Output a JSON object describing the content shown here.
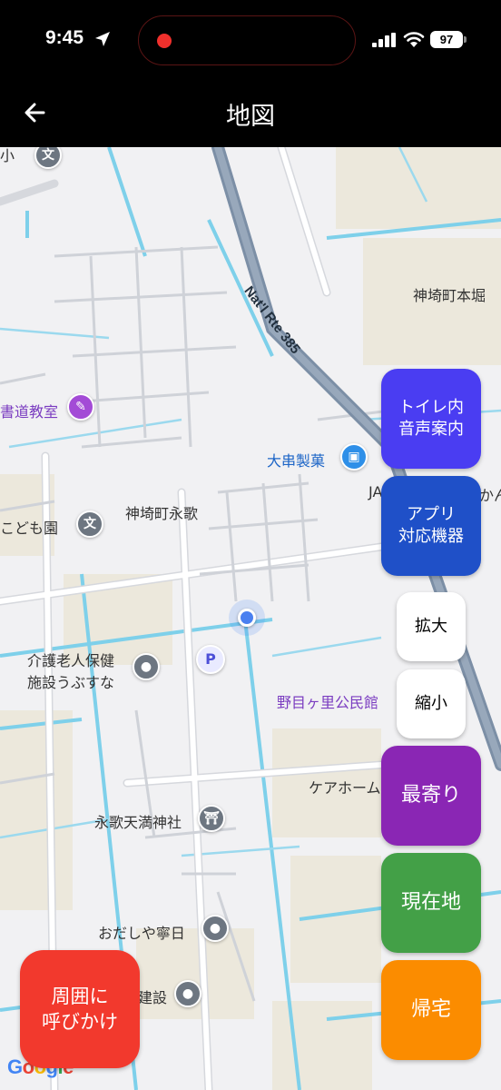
{
  "status_bar": {
    "time": "9:45",
    "battery": "97"
  },
  "header": {
    "title": "地図"
  },
  "map": {
    "labels": {
      "calligraphy": "書道教室",
      "daikan": "大串製菓",
      "kanzaki_hon": "神埼町本堀",
      "kanzaki_eika": "神埼町永歌",
      "kodomoen": "こども園",
      "ja": "JA",
      "kan": "かん",
      "kaigo_1": "介護老人保健",
      "kaigo_2": "施設うぶすな",
      "nomeri": "野目ヶ里公民館",
      "carehome": "ケアホーム",
      "shrine": "永歌天満神社",
      "odashi": "おだしや寧日",
      "kensetsu": "建設",
      "route": "Nat'l Rte 385",
      "top_left": "小"
    },
    "google_logo": [
      "G",
      "o",
      "o",
      "g",
      "l",
      "e"
    ]
  },
  "buttons": {
    "toilet_line1": "トイレ内",
    "toilet_line2": "音声案内",
    "app_line1": "アプリ",
    "app_line2": "対応機器",
    "zoom_in": "拡大",
    "zoom_out": "縮小",
    "nearest": "最寄り",
    "current": "現在地",
    "home": "帰宅",
    "call_line1": "周囲に",
    "call_line2": "呼びかけ"
  },
  "colors": {
    "toilet": "#4a3df2",
    "app": "#1f50c8",
    "nearest": "#8a26b4",
    "current": "#43a047",
    "home": "#fb8c00",
    "call": "#f2392d"
  }
}
